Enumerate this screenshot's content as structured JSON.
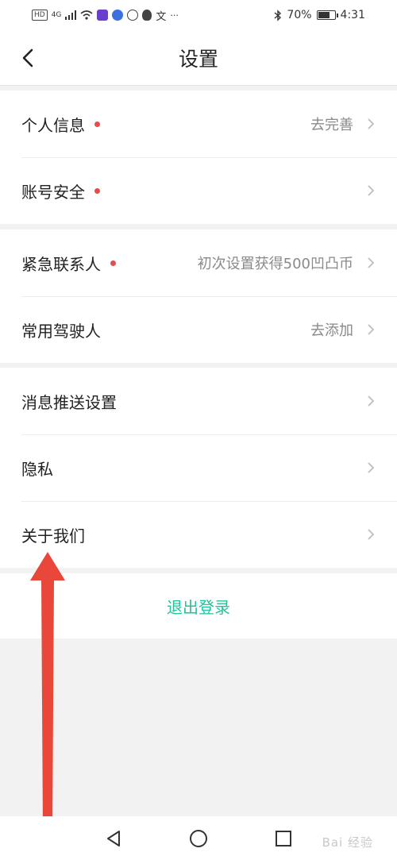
{
  "status_bar": {
    "network": "HD",
    "signal_type": "4G",
    "battery_percent": "70%",
    "battery_level": 0.7,
    "time": "4:31",
    "icons": [
      "signal-icon",
      "wifi-icon",
      "app-icon",
      "music-icon",
      "gallery-icon",
      "qq-icon",
      "translate-icon",
      "more-icon",
      "bluetooth-icon",
      "battery-icon"
    ]
  },
  "header": {
    "title": "设置",
    "back_icon": "chevron-left-icon"
  },
  "groups": [
    {
      "items": [
        {
          "label": "个人信息",
          "dot": true,
          "value": "去完善"
        },
        {
          "label": "账号安全",
          "dot": true,
          "value": ""
        }
      ]
    },
    {
      "items": [
        {
          "label": "紧急联系人",
          "dot": true,
          "value": "初次设置获得500凹凸币"
        },
        {
          "label": "常用驾驶人",
          "dot": false,
          "value": "去添加"
        }
      ]
    },
    {
      "items": [
        {
          "label": "消息推送设置",
          "dot": false,
          "value": ""
        },
        {
          "label": "隐私",
          "dot": false,
          "value": ""
        },
        {
          "label": "关于我们",
          "dot": false,
          "value": ""
        }
      ]
    }
  ],
  "logout": {
    "label": "退出登录"
  },
  "nav_bar": {
    "icons": [
      "back-triangle-icon",
      "home-circle-icon",
      "recents-square-icon"
    ]
  },
  "watermark": "Bai 经验",
  "colors": {
    "accent": "#1ec49a",
    "dot": "#e84b4b",
    "annotation": "#e8473a"
  }
}
